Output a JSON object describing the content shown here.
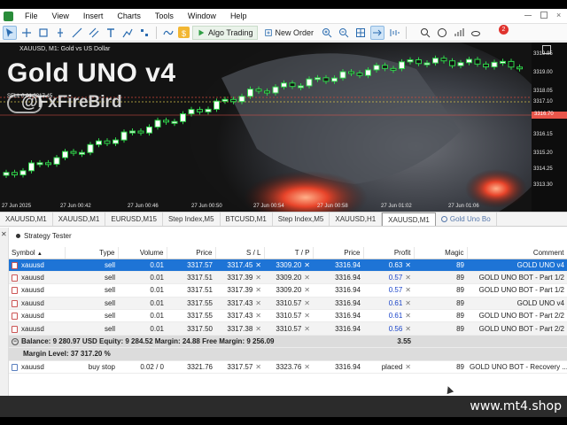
{
  "menu": [
    "File",
    "View",
    "Insert",
    "Charts",
    "Tools",
    "Window",
    "Help"
  ],
  "toolbar": {
    "algo_trading": "Algo Trading",
    "new_order": "New Order",
    "notification_count": "2"
  },
  "chart": {
    "info_line": "XAUUSD, M1:  Gold vs US Dollar",
    "title": "Gold UNO v4",
    "handle": "@FxFireBird",
    "overlay_label": "SELL 0.01  3317.45",
    "price_labels": [
      "3319.95",
      "3319.00",
      "3318.05",
      "3317.10",
      "3316.15",
      "3315.20",
      "3314.25",
      "3313.30"
    ],
    "current_price": "3316.70",
    "time_labels": [
      "27 Jun 2025",
      "27 Jun 00:42",
      "27 Jun 00:46",
      "27 Jun 00:50",
      "27 Jun 00:54",
      "27 Jun 00:58",
      "27 Jun 01:02",
      "27 Jun 01:06"
    ]
  },
  "tabs": [
    "XAUUSD,M1",
    "XAUUSD,M1",
    "EURUSD,M15",
    "Step Index,M5",
    "BTCUSD,M1",
    "Step Index,M5",
    "XAUUSD,H1",
    "XAUUSD,M1",
    "Gold Uno Bo"
  ],
  "panel": {
    "title": "Strategy Tester",
    "columns": [
      "Symbol",
      "Type",
      "Volume",
      "Price",
      "S / L",
      "T / P",
      "Price",
      "Profit",
      "Magic",
      "Comment"
    ],
    "rows": [
      {
        "symbol": "xauusd",
        "type": "sell",
        "volume": "0.01",
        "price": "3317.57",
        "sl": "3317.45",
        "tp": "3309.20",
        "cur": "3316.94",
        "profit": "0.63",
        "magic": "89",
        "comment": "GOLD UNO v4"
      },
      {
        "symbol": "xauusd",
        "type": "sell",
        "volume": "0.01",
        "price": "3317.51",
        "sl": "3317.39",
        "tp": "3309.20",
        "cur": "3316.94",
        "profit": "0.57",
        "magic": "89",
        "comment": "GOLD UNO BOT - Part 1/2"
      },
      {
        "symbol": "xauusd",
        "type": "sell",
        "volume": "0.01",
        "price": "3317.51",
        "sl": "3317.39",
        "tp": "3309.20",
        "cur": "3316.94",
        "profit": "0.57",
        "magic": "89",
        "comment": "GOLD UNO BOT - Part 1/2"
      },
      {
        "symbol": "xauusd",
        "type": "sell",
        "volume": "0.01",
        "price": "3317.55",
        "sl": "3317.43",
        "tp": "3310.57",
        "cur": "3316.94",
        "profit": "0.61",
        "magic": "89",
        "comment": "GOLD UNO v4"
      },
      {
        "symbol": "xauusd",
        "type": "sell",
        "volume": "0.01",
        "price": "3317.55",
        "sl": "3317.43",
        "tp": "3310.57",
        "cur": "3316.94",
        "profit": "0.61",
        "magic": "89",
        "comment": "GOLD UNO BOT - Part 2/2"
      },
      {
        "symbol": "xauusd",
        "type": "sell",
        "volume": "0.01",
        "price": "3317.50",
        "sl": "3317.38",
        "tp": "3310.57",
        "cur": "3316.94",
        "profit": "0.56",
        "magic": "89",
        "comment": "GOLD UNO BOT - Part 2/2"
      }
    ],
    "summary_line1": "Balance: 9 280.97 USD  Equity: 9 284.52  Margin: 24.88  Free Margin: 9 256.09",
    "summary_profit": "3.55",
    "summary_line2": "Margin Level: 37 317.20 %",
    "pending": {
      "symbol": "xauusd",
      "type": "buy stop",
      "volume": "0.02 / 0",
      "price": "3321.76",
      "sl": "3317.57",
      "tp": "3323.76",
      "cur": "3316.94",
      "profit": "placed",
      "magic": "89",
      "comment": "GOLD UNO BOT - Recovery ..."
    }
  },
  "watermark": "www.mt4.shop"
}
